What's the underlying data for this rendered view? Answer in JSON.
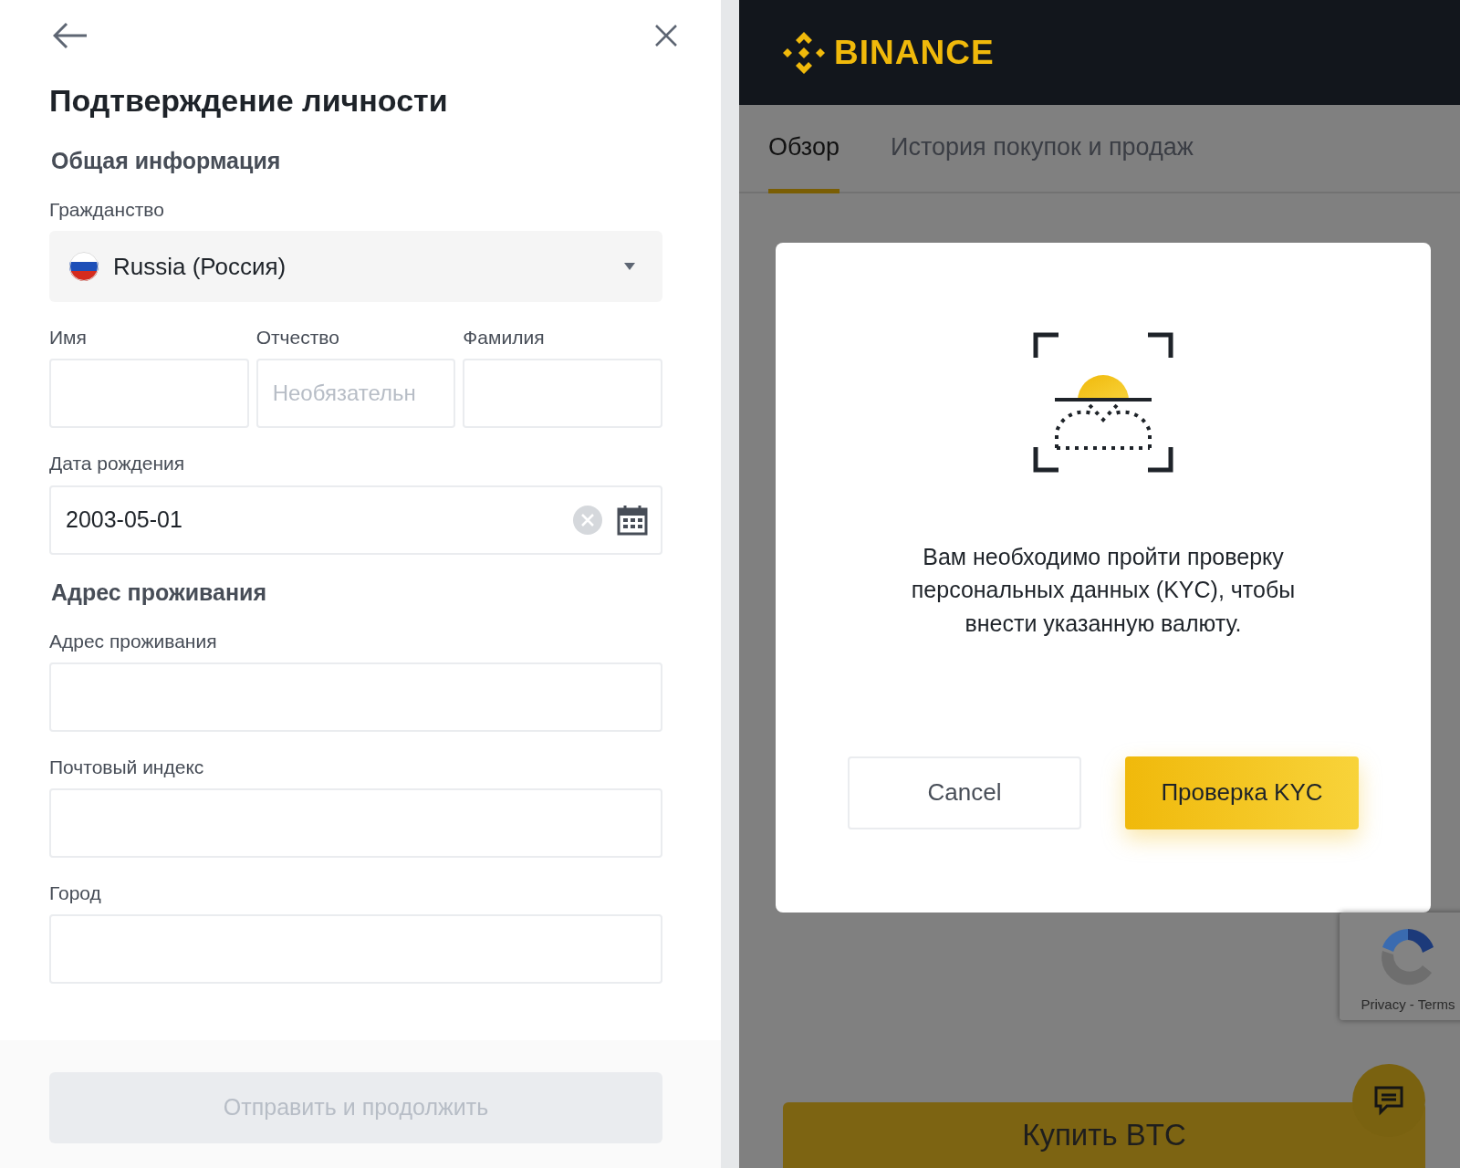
{
  "form": {
    "title": "Подтверждение личности",
    "fields": [
      {
        "kind": "heading",
        "text": "Общая информация"
      },
      {
        "kind": "select",
        "label": "Гражданство",
        "value": "Russia (Россия)"
      },
      {
        "kind": "triple",
        "items": [
          {
            "label": "Имя"
          },
          {
            "label": "Отчество",
            "placeholder": "Необязательн"
          },
          {
            "label": "Фамилия"
          }
        ]
      },
      {
        "kind": "date",
        "label": "Дата рождения",
        "value": "2003-05-01"
      },
      {
        "kind": "heading",
        "text": "Адрес проживания"
      },
      {
        "kind": "text",
        "label": "Адрес проживания"
      },
      {
        "kind": "text",
        "label": "Почтовый индекс"
      },
      {
        "kind": "text",
        "label": "Город"
      }
    ],
    "submit": {
      "label": "Отправить и продолжить",
      "disabled": true
    }
  },
  "brand": {
    "name": "BINANCE"
  },
  "tabs": [
    {
      "label": "Обзор",
      "selected": true
    },
    {
      "label": "История покупок и продаж",
      "selected": false
    }
  ],
  "dialog": {
    "message": "Вам необходимо пройти проверку персональных данных (KYC), чтобы внести указанную валюту.",
    "buttons": [
      {
        "label": "Cancel",
        "kind": "secondary"
      },
      {
        "label": "Проверка KYC",
        "kind": "primary"
      }
    ]
  },
  "recaptcha": {
    "links": "Privacy - Terms"
  },
  "buy_button": {
    "label": "Купить BTC"
  }
}
